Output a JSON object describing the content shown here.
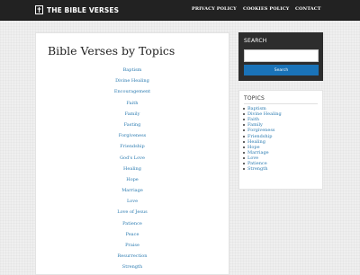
{
  "header": {
    "brand": "THE BIBLE VERSES",
    "brand_icon": "bible-icon",
    "nav": [
      "PRIVACY POLICY",
      "COOKIES POLICY",
      "CONTACT"
    ]
  },
  "main": {
    "title": "Bible Verses by Topics",
    "topics": [
      "Baptism",
      "Divine Healing",
      "Encouragement",
      "Faith",
      "Family",
      "Fasting",
      "Forgiveness",
      "Friendship",
      "God's Love",
      "Healing",
      "Hope",
      "Marriage",
      "Love",
      "Love of Jesus",
      "Patience",
      "Peace",
      "Praise",
      "Resurrection",
      "Strength"
    ]
  },
  "sidebar": {
    "search": {
      "title": "SEARCH",
      "input_value": "",
      "button_label": "Search"
    },
    "topics": {
      "title": "TOPICS",
      "items": [
        "Baptism",
        "Divine Healing",
        "Faith",
        "Family",
        "Forgiveness",
        "Friendship",
        "Healing",
        "Hope",
        "Marriage",
        "Love",
        "Patience",
        "Strength"
      ]
    }
  },
  "colors": {
    "header_bg": "#222222",
    "link": "#2a7ab0",
    "search_widget_bg": "#2d2d2d",
    "button": "#1a73b8"
  }
}
